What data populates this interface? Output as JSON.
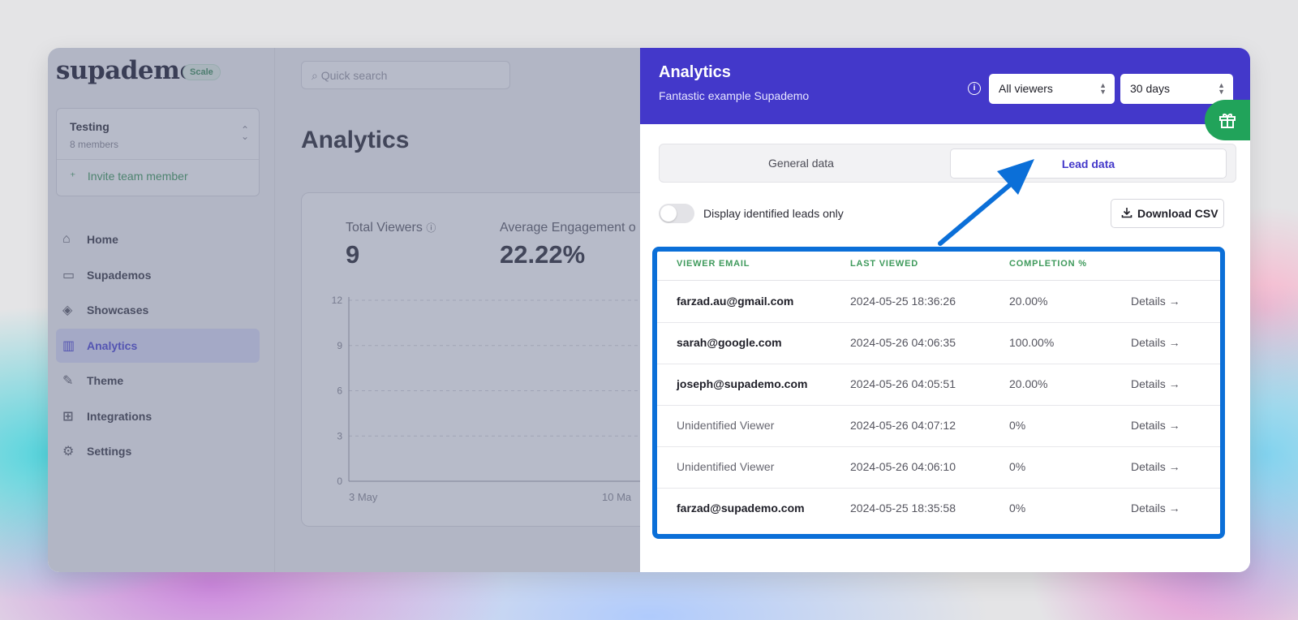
{
  "brand": {
    "logo": "supademo",
    "plan": "Scale"
  },
  "team": {
    "name": "Testing",
    "members": "8 members",
    "invite_label": "Invite team member"
  },
  "nav": [
    {
      "label": "Home",
      "icon": "home-icon",
      "glyph": "⌂"
    },
    {
      "label": "Supademos",
      "icon": "folder-icon",
      "glyph": "▭"
    },
    {
      "label": "Showcases",
      "icon": "layers-icon",
      "glyph": "◈"
    },
    {
      "label": "Analytics",
      "icon": "bar-chart-icon",
      "glyph": "▥",
      "active": true
    },
    {
      "label": "Theme",
      "icon": "brush-icon",
      "glyph": "✎"
    },
    {
      "label": "Integrations",
      "icon": "grid-plus-icon",
      "glyph": "⊞"
    },
    {
      "label": "Settings",
      "icon": "gear-icon",
      "glyph": "⚙"
    }
  ],
  "search": {
    "placeholder": "Quick search"
  },
  "page": {
    "title": "Analytics"
  },
  "stats": {
    "total_viewers_label": "Total Viewers",
    "total_viewers_value": "9",
    "avg_engagement_label": "Average Engagement o",
    "avg_engagement_value": "22.22%"
  },
  "chart_data": {
    "type": "line",
    "y_ticks": [
      "12",
      "9",
      "6",
      "3",
      "0"
    ],
    "x_ticks": [
      "3 May",
      "10 Ma"
    ],
    "ylim": [
      0,
      12
    ],
    "grid": true
  },
  "panel": {
    "title": "Analytics",
    "subtitle": "Fantastic example Supademo",
    "viewer_filter": "All viewers",
    "range_filter": "30 days",
    "tabs": [
      {
        "label": "General data"
      },
      {
        "label": "Lead data",
        "active": true
      }
    ],
    "toggle_label": "Display identified leads only",
    "download_label": "Download CSV",
    "columns": [
      "VIEWER EMAIL",
      "LAST VIEWED",
      "COMPLETION %"
    ],
    "rows": [
      {
        "email": "farzad.au@gmail.com",
        "last_viewed": "2024-05-25 18:36:26",
        "completion": "20.00%",
        "details": "Details →",
        "identified": true
      },
      {
        "email": "sarah@google.com",
        "last_viewed": "2024-05-26 04:06:35",
        "completion": "100.00%",
        "details": "Details →",
        "identified": true
      },
      {
        "email": "joseph@supademo.com",
        "last_viewed": "2024-05-26 04:05:51",
        "completion": "20.00%",
        "details": "Details →",
        "identified": true
      },
      {
        "email": "Unidentified Viewer",
        "last_viewed": "2024-05-26 04:07:12",
        "completion": "0%",
        "details": "Details →",
        "identified": false
      },
      {
        "email": "Unidentified Viewer",
        "last_viewed": "2024-05-26 04:06:10",
        "completion": "0%",
        "details": "Details →",
        "identified": false
      },
      {
        "email": "farzad@supademo.com",
        "last_viewed": "2024-05-25 18:35:58",
        "completion": "0%",
        "details": "Details →",
        "identified": true
      }
    ]
  },
  "colors": {
    "brand": "#4338ca",
    "highlight": "#0b6fd8",
    "gift": "#21a35a",
    "header_green": "#3f9a5c"
  }
}
